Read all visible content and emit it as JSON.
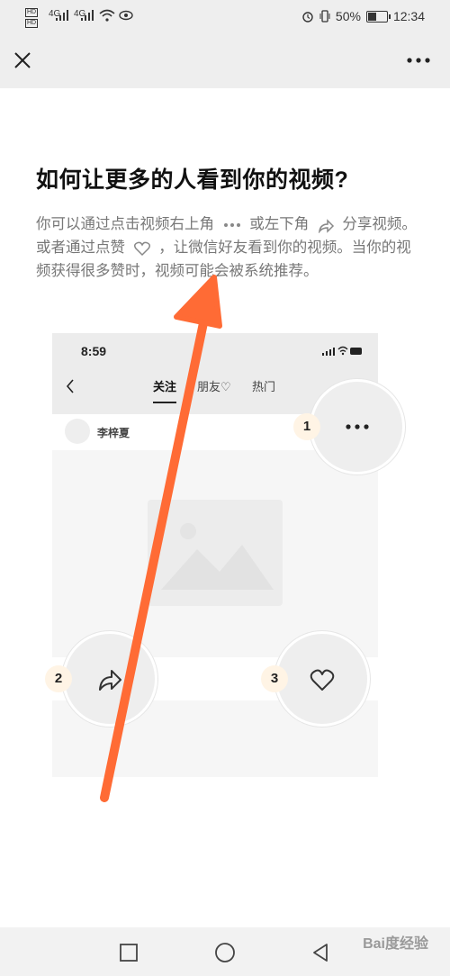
{
  "status_bar": {
    "hd1": "HD",
    "hd2": "HD",
    "sig1": "4G",
    "sig2": "4G",
    "battery_pct": "50%",
    "time": "12:34"
  },
  "article": {
    "title": "如何让更多的人看到你的视频?",
    "desc": {
      "p1": "你可以通过点击视频右上角",
      "p2": "或左下角",
      "p3": "分享视频。或者通过点赞",
      "p4": "，让微信好友看到你的视频。当你的视频获得很多赞时，视频可能会被系统推荐。"
    }
  },
  "illustration": {
    "phone_time": "8:59",
    "tabs": [
      "关注",
      "朋友♡",
      "热门"
    ],
    "username": "李梓夏",
    "badges": [
      "1",
      "2",
      "3"
    ]
  },
  "watermark": "Bai度经验",
  "icons": {
    "close": "close-icon",
    "more": "more-icon",
    "share": "share-icon",
    "heart": "heart-icon"
  },
  "colors": {
    "arrow": "#ff6b35",
    "badge_bg": "#fff4e5"
  }
}
